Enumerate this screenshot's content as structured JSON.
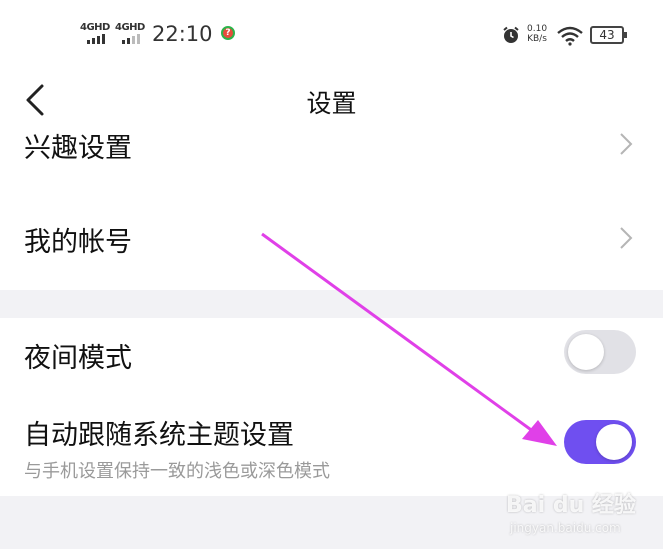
{
  "status_bar": {
    "signal1": "4GHD",
    "signal2": "4GHD",
    "time": "22:10",
    "net_speed_value": "0.10",
    "net_speed_unit": "KB/s",
    "battery": "43"
  },
  "header": {
    "title": "设置"
  },
  "settings": {
    "partial_item_label": "兴趣设置",
    "account_label": "我的帐号",
    "night_mode_label": "夜间模式",
    "night_mode_enabled": false,
    "follow_system_label": "自动跟随系统主题设置",
    "follow_system_desc": "与手机设置保持一致的浅色或深色模式",
    "follow_system_enabled": true
  },
  "colors": {
    "accent": "#6f4ff0",
    "toggle_off": "#e1e1e6",
    "annotation_arrow": "#e040e8"
  },
  "watermark": {
    "brand": "Bai du 经验",
    "url": "jingyan.baidu.com"
  }
}
